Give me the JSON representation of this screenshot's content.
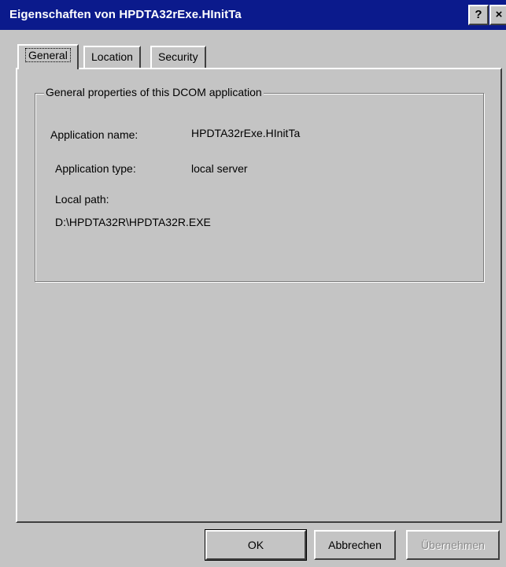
{
  "window": {
    "title": "Eigenschaften von HPDTA32rExe.HInitTa",
    "help_button": "?",
    "close_button": "×"
  },
  "tabs": [
    {
      "label": "General",
      "selected": true
    },
    {
      "label": "Location",
      "selected": false
    },
    {
      "label": "Security",
      "selected": false
    }
  ],
  "general": {
    "group_title": "General properties of this DCOM application",
    "app_name_label": "Application name:",
    "app_name_value": "HPDTA32rExe.HInitTa",
    "app_type_label": "Application type:",
    "app_type_value": "local server",
    "local_path_label": "Local path:",
    "local_path_value": "D:\\HPDTA32R\\HPDTA32R.EXE"
  },
  "buttons": {
    "ok": "OK",
    "cancel": "Abbrechen",
    "apply": "Übernehmen"
  },
  "colors": {
    "titlebar": "#0b1a8c",
    "face": "#c4c4c4"
  }
}
